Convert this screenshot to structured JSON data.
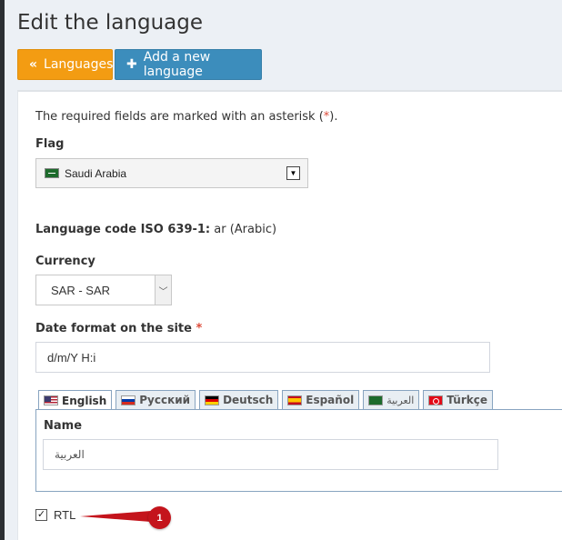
{
  "page": {
    "title": "Edit the language"
  },
  "toolbar": {
    "back_label": "Languages",
    "back_icon": "double-chevron-left-icon",
    "add_label": "Add a new language",
    "add_icon": "plus-icon",
    "back_color": "#f39c12",
    "add_color": "#3c8dbc"
  },
  "form": {
    "required_note_prefix": "The required fields are marked with an asterisk (",
    "required_note_star": "*",
    "required_note_suffix": ").",
    "flag_label": "Flag",
    "flag_value": "Saudi Arabia",
    "lang_code_label": "Language code ISO 639-1:",
    "lang_code_value": " ar (Arabic)",
    "currency_label": "Currency",
    "currency_value": "SAR - SAR",
    "date_format_label": "Date format on the site",
    "date_format_star": "*",
    "date_format_value": "d/m/Y H:i",
    "tabs": [
      {
        "label": "English"
      },
      {
        "label": "Русский"
      },
      {
        "label": "Deutsch"
      },
      {
        "label": "Español"
      },
      {
        "label": "العربية"
      },
      {
        "label": "Türkçe"
      }
    ],
    "name_label": "Name",
    "name_value": "العربية",
    "rtl_label": "RTL",
    "rtl_checked": true
  },
  "annotation": {
    "badge": "1",
    "color": "#c4141c"
  }
}
